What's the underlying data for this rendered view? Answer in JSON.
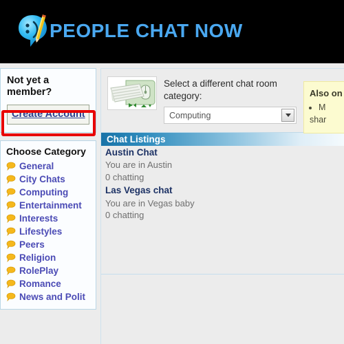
{
  "header": {
    "logo_icon": "smiley-pencil-logo-icon",
    "brand": "PEOPLE CHAT NOW"
  },
  "sidebar": {
    "member_panel": {
      "title": "Not yet a member?",
      "create_account_label": "Create Account",
      "highlight_color": "#e80000"
    },
    "category_panel": {
      "title": "Choose Category",
      "items": [
        {
          "label": "General",
          "icon": "speech-bubble-icon"
        },
        {
          "label": "City Chats",
          "icon": "speech-bubble-icon"
        },
        {
          "label": "Computing",
          "icon": "speech-bubble-icon"
        },
        {
          "label": "Entertainment",
          "icon": "speech-bubble-icon"
        },
        {
          "label": "Interests",
          "icon": "speech-bubble-icon"
        },
        {
          "label": "Lifestyles",
          "icon": "speech-bubble-icon"
        },
        {
          "label": "Peers",
          "icon": "speech-bubble-icon"
        },
        {
          "label": "Religion",
          "icon": "speech-bubble-icon"
        },
        {
          "label": "RolePlay",
          "icon": "speech-bubble-icon"
        },
        {
          "label": "Romance",
          "icon": "speech-bubble-icon"
        },
        {
          "label": "News and Polit",
          "icon": "speech-bubble-icon"
        }
      ]
    }
  },
  "main": {
    "category_selector": {
      "thumbnail_icon": "keyboard-mouse-icon",
      "label": "Select a different chat room category:",
      "selected_value": "Computing",
      "dropdown_icon": "chevron-down-icon"
    },
    "also_box": {
      "title": "Also on",
      "bullet": "M",
      "tail": "shar"
    },
    "listings": {
      "header": "Chat Listings",
      "rooms": [
        {
          "title": "Austin Chat",
          "description": "You are in Austin",
          "count": "0 chatting"
        },
        {
          "title": "Las Vegas chat",
          "description": "You are in Vegas baby",
          "count": "0 chatting"
        }
      ]
    }
  }
}
